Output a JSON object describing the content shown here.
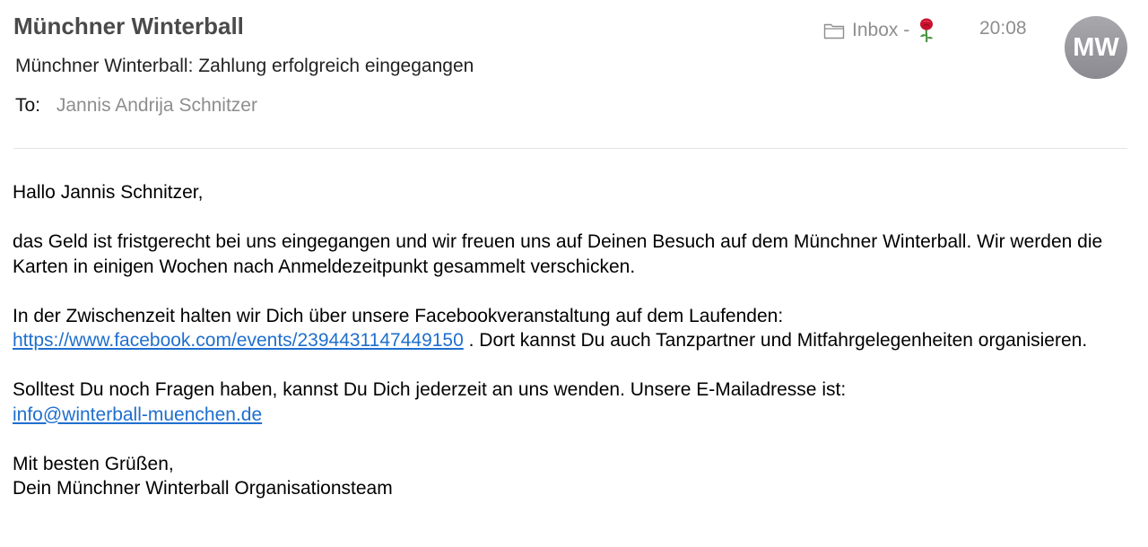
{
  "header": {
    "sender": "Münchner Winterball",
    "subject": "Münchner Winterball: Zahlung erfolgreich eingegangen",
    "to_label": "To:",
    "to_value": "Jannis Andrija Schnitzer",
    "mailbox": "Inbox -",
    "time": "20:08",
    "avatar_initials": "MW",
    "icons": {
      "folder": "folder-icon",
      "flag": "rose-icon"
    }
  },
  "body": {
    "greeting": "Hallo Jannis Schnitzer,",
    "paragraph1": "das Geld ist fristgerecht bei uns eingegangen und wir freuen uns auf Deinen Besuch auf dem Münchner Winterball. Wir werden die Karten in einigen Wochen nach Anmeldezeitpunkt gesammelt verschicken.",
    "paragraph2_intro": "In der Zwischenzeit halten wir Dich über unsere Facebookveranstaltung auf dem Laufenden:",
    "facebook_link": "https://www.facebook.com/events/2394431147449150",
    "paragraph2_rest": " . Dort kannst Du auch Tanzpartner und Mitfahrgelegenheiten organisieren.",
    "paragraph3_intro": "Solltest Du noch Fragen haben, kannst Du Dich jederzeit an uns wenden. Unsere E-Mailadresse ist:",
    "email_link": "info@winterball-muenchen.de",
    "closing": "Mit besten Grüßen,",
    "signature": "Dein Münchner Winterball Organisationsteam"
  },
  "colors": {
    "link": "#1f6fce",
    "muted": "#8e8e8e",
    "avatar": "#9a9aa0"
  }
}
